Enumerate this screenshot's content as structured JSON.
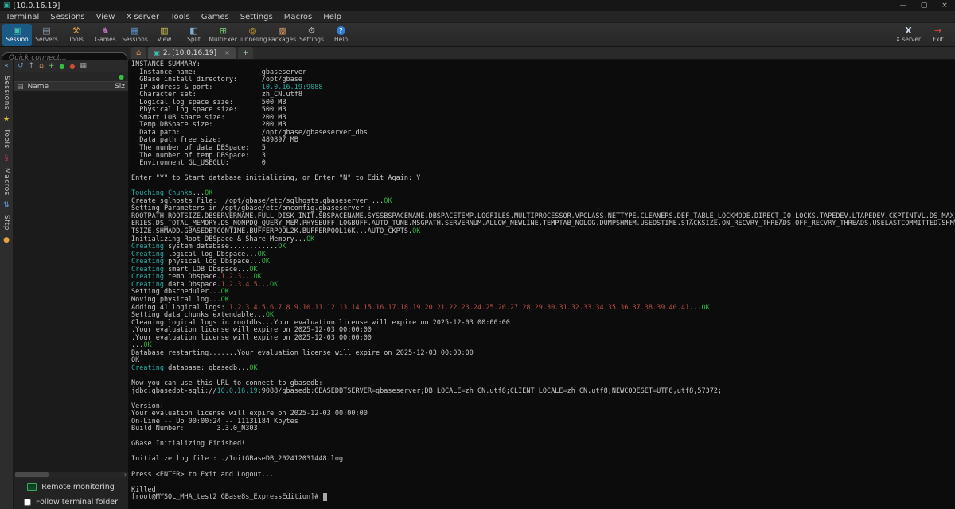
{
  "window": {
    "title": "[10.0.16.19]"
  },
  "icons": {
    "logo": "▣",
    "minimize": "—",
    "maximize": "▢",
    "close": "×",
    "close_tab": "×",
    "session": "▣",
    "servers": "▤",
    "tools": "⚒",
    "games": "♞",
    "sessions": "▦",
    "view": "▥",
    "split": "◧",
    "multiexec": "⊞",
    "tunneling": "◎",
    "packages": "▩",
    "settings": "⚙",
    "help": "?",
    "xserver": "X",
    "exit": "→",
    "collapse": "«",
    "star": "★",
    "macro": "§",
    "sftp": "⇅",
    "dot": "●",
    "refresh": "↺",
    "up": "↑",
    "home_dir": "⌂",
    "new_folder": "+",
    "grid": "▦",
    "list_glyph": "▤",
    "home_tab": "⌂",
    "terminal_tab": "▣",
    "chev_right": "›"
  },
  "menu": {
    "items": [
      "Terminal",
      "Sessions",
      "View",
      "X server",
      "Tools",
      "Games",
      "Settings",
      "Macros",
      "Help"
    ]
  },
  "toolbar": {
    "buttons": [
      "Session",
      "Servers",
      "Tools",
      "Games",
      "Sessions",
      "View",
      "Split",
      "MultiExec",
      "Tunneling",
      "Packages",
      "Settings",
      "Help"
    ],
    "right_buttons": [
      "X server",
      "Exit"
    ]
  },
  "sidebar": {
    "quick_connect": "Quick connect...",
    "columns": {
      "name": "Name",
      "size": "Siz"
    },
    "side_tabs": [
      "Sessions",
      "Tools",
      "Macros",
      "Sftp"
    ],
    "remote_monitoring": "Remote monitoring",
    "follow_terminal_folder": "Follow terminal folder"
  },
  "tabs": {
    "active_label": "2. [10.0.16.19]",
    "plus": "+"
  },
  "colors": {
    "terminal_cyan": "#2aaaa2",
    "terminal_green": "#33b045",
    "terminal_red": "#bf4f45",
    "accent_blue": "#1c5a86"
  },
  "terminal": {
    "lines": [
      [
        [
          "INSTANCE SUMMARY:"
        ]
      ],
      [
        [
          "  Instance name:                gbaseserver"
        ]
      ],
      [
        [
          "  GBase install directory:      /opt/gbase"
        ]
      ],
      [
        [
          "  IP address & port:            "
        ],
        [
          "10.0.16.19:9088",
          "c"
        ]
      ],
      [
        [
          "  Character set:                zh_CN.utf8"
        ]
      ],
      [
        [
          "  Logical log space size:       500 MB"
        ]
      ],
      [
        [
          "  Physical log space size:      500 MB"
        ]
      ],
      [
        [
          "  Smart LOB space size:         200 MB"
        ]
      ],
      [
        [
          "  Temp DBSpace size:            200 MB"
        ]
      ],
      [
        [
          "  Data path:                    /opt/gbase/gbaseserver_dbs"
        ]
      ],
      [
        [
          "  Data path free size:          489897 MB"
        ]
      ],
      [
        [
          "  The number of data DBSpace:   5"
        ]
      ],
      [
        [
          "  The number of temp DBSpace:   3"
        ]
      ],
      [
        [
          "  Environment GL_USEGLU:        0"
        ]
      ],
      [],
      [
        [
          "Enter \"Y\" to Start database initializing, or Enter \"N\" to Edit Again: Y"
        ]
      ],
      [],
      [
        [
          "Touching Chunks",
          "c"
        ],
        [
          "..."
        ],
        [
          "OK",
          "g"
        ]
      ],
      [
        [
          "Create sqlhosts File:  /opt/gbase/etc/sqlhosts.gbaseserver ..."
        ],
        [
          "OK",
          "g"
        ]
      ],
      [
        [
          "Setting Parameters in /opt/gbase/etc/onconfig.gbaseserver :"
        ]
      ],
      [
        [
          "ROOTPATH.ROOTSIZE.DBSERVERNAME.FULL_DISK_INIT.SBSPACENAME.SYSSBSPACENAME.DBSPACETEMP.LOGFILES.MULTIPROCESSOR.VPCLASS.NETTYPE.CLEANERS.DEF_TABLE_LOCKMODE.DIRECT_IO.LOCKS.TAPEDEV.LTAPEDEV.CKPTINTVL.DS_MAX_QU"
        ]
      ],
      [
        [
          "ERIES.DS_TOTAL_MEMORY.DS_NONPDQ_QUERY_MEM.PHYSBUFF.LOGBUFF.AUTO_TUNE.MSGPATH.SERVERNUM.ALLOW_NEWLINE.TEMPTAB_NOLOG.DUMPSHMEM.USEOSTIME.STACKSIZE.ON_RECVRY_THREADS.OFF_RECVRY_THREADS.USELASTCOMMITTED.SHMVIR"
        ]
      ],
      [
        [
          "TSIZE.SHMADD.GBASEDBTCONTIME.BUFFERPOOL2K.BUFFERPOOL16K...AUTO_CKPTS."
        ],
        [
          "OK",
          "g"
        ]
      ],
      [
        [
          "Initializing Root DBSpace & Share Memory..."
        ],
        [
          "OK",
          "g"
        ]
      ],
      [
        [
          "Creating",
          "c"
        ],
        [
          " system database............"
        ],
        [
          "OK",
          "g"
        ]
      ],
      [
        [
          "Creating",
          "c"
        ],
        [
          " logical log Dbspace..."
        ],
        [
          "OK",
          "g"
        ]
      ],
      [
        [
          "Creating",
          "c"
        ],
        [
          " physical log Dbspace..."
        ],
        [
          "OK",
          "g"
        ]
      ],
      [
        [
          "Creating",
          "c"
        ],
        [
          " smart LOB Dbspace..."
        ],
        [
          "OK",
          "g"
        ]
      ],
      [
        [
          "Creating",
          "c"
        ],
        [
          " temp Dbspace."
        ],
        [
          "1.2.3",
          "r"
        ],
        [
          "..."
        ],
        [
          "OK",
          "g"
        ]
      ],
      [
        [
          "Creating",
          "c"
        ],
        [
          " data Dbspace."
        ],
        [
          "1.2.3.4.5",
          "r"
        ],
        [
          "..."
        ],
        [
          "OK",
          "g"
        ]
      ],
      [
        [
          "Setting dbscheduler..."
        ],
        [
          "OK",
          "g"
        ]
      ],
      [
        [
          "Moving physical log..."
        ],
        [
          "OK",
          "g"
        ]
      ],
      [
        [
          "Adding 41 logical logs: "
        ],
        [
          "1.2.3.4.5.6.7.8.9.10.11.12.13.14.15.16.17.18.19.20.21.22.23.24.25.26.27.28.29.30.31.32.33.34.35.36.37.38.39.40.41",
          "r"
        ],
        [
          "..."
        ],
        [
          "OK",
          "g"
        ]
      ],
      [
        [
          "Setting data chunks extendable..."
        ],
        [
          "OK",
          "g"
        ]
      ],
      [
        [
          "Cleaning logical logs in rootdbs...Your evaluation license will expire on 2025-12-03 00:00:00"
        ]
      ],
      [
        [
          ".Your evaluation license will expire on 2025-12-03 00:00:00"
        ]
      ],
      [
        [
          ".Your evaluation license will expire on 2025-12-03 00:00:00"
        ]
      ],
      [
        [
          "..."
        ],
        [
          "OK",
          "g"
        ]
      ],
      [
        [
          "Database restarting.......Your evaluation license will expire on 2025-12-03 00:00:00"
        ]
      ],
      [
        [
          "OK"
        ]
      ],
      [
        [
          "Creating",
          "c"
        ],
        [
          " database: gbasedb..."
        ],
        [
          "OK",
          "g"
        ]
      ],
      [],
      [
        [
          "Now you can use this URL to connect to gbasedb:"
        ]
      ],
      [
        [
          "jdbc:gbasedbt-sqli://"
        ],
        [
          "10.0.16.19",
          "c"
        ],
        [
          ":9088/gbasedb:GBASEDBTSERVER=gbaseserver;DB_LOCALE=zh_CN.utf8;CLIENT_LOCALE=zh_CN.utf8;NEWCODESET=UTF8,utf8,57372;"
        ]
      ],
      [],
      [
        [
          "Version:"
        ]
      ],
      [
        [
          "Your evaluation license will expire on 2025-12-03 00:00:00"
        ]
      ],
      [
        [
          "On-Line -- Up 00:00:24 -- 11131184 Kbytes"
        ]
      ],
      [
        [
          "Build Number:        3.3.0_N303"
        ]
      ],
      [],
      [
        [
          "GBase Initializing Finished!"
        ]
      ],
      [],
      [
        [
          "Initialize log file : ./InitGBaseDB_202412031448.log"
        ]
      ],
      [],
      [
        [
          "Press <ENTER> to Exit and Logout..."
        ]
      ],
      [],
      [
        [
          "Killed"
        ]
      ],
      [
        [
          "[root@MYSQL_MHA_test2 GBase8s_ExpressEdition]# "
        ],
        [
          " ",
          "k"
        ]
      ]
    ]
  }
}
